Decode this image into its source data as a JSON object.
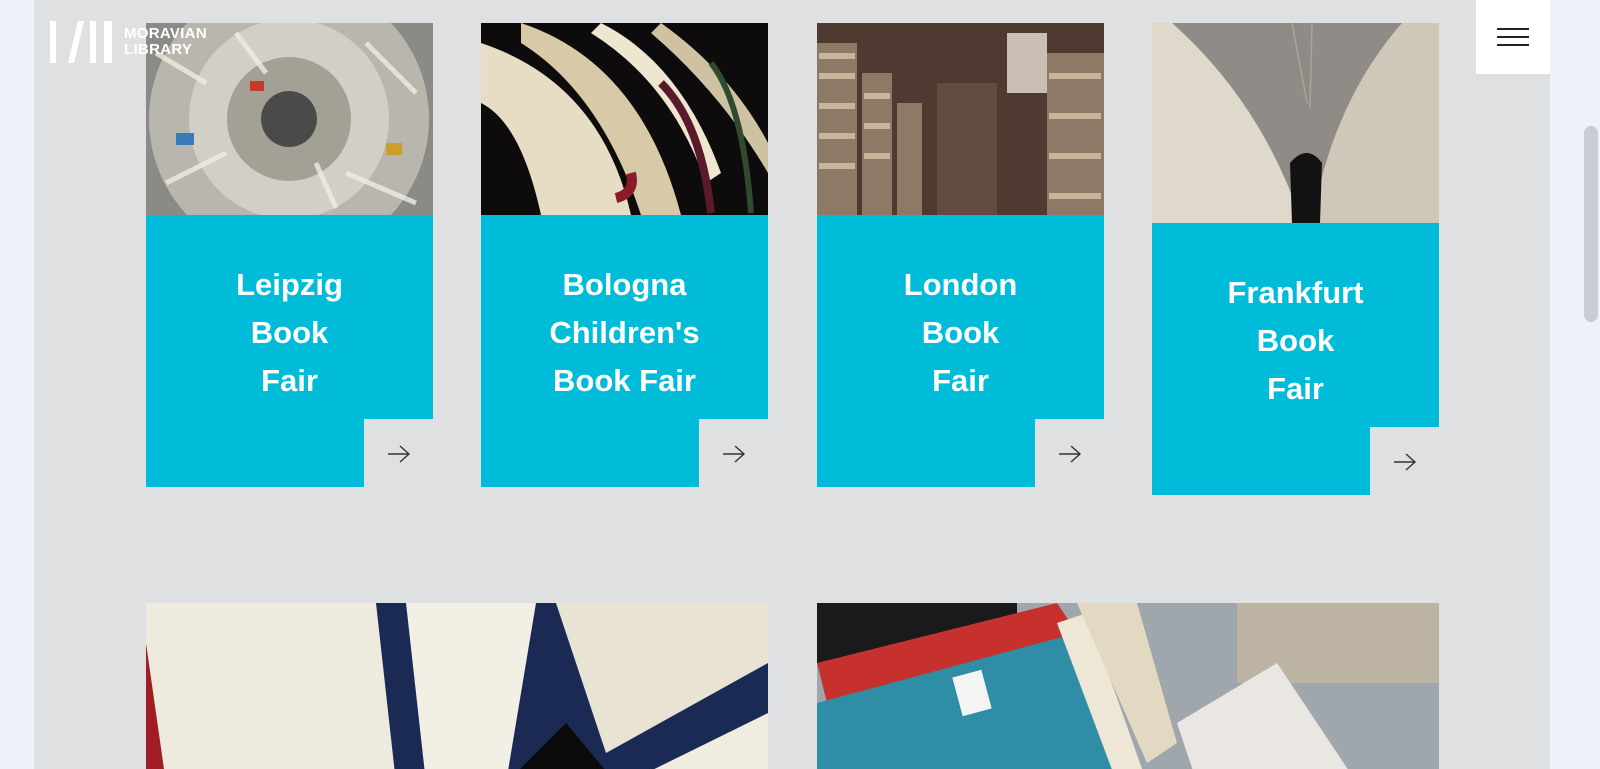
{
  "header": {
    "logo_line1": "MORAVIAN",
    "logo_line2": "LIBRARY",
    "menu_icon": "hamburger-menu-icon"
  },
  "fairs": [
    {
      "title_lines": [
        "Leipzig",
        "Book",
        "Fair"
      ],
      "arrow_icon": "arrow-right-icon"
    },
    {
      "title_lines": [
        "Bologna",
        "Children's",
        "Book Fair"
      ],
      "arrow_icon": "arrow-right-icon"
    },
    {
      "title_lines": [
        "London",
        "Book",
        "Fair"
      ],
      "arrow_icon": "arrow-right-icon"
    },
    {
      "title_lines": [
        "Frankfurt",
        "Book",
        "Fair"
      ],
      "arrow_icon": "arrow-right-icon"
    }
  ],
  "colors": {
    "accent": "#00bcd8",
    "page_background": "#dfe0e2",
    "outer_background": "#eef1f9"
  }
}
